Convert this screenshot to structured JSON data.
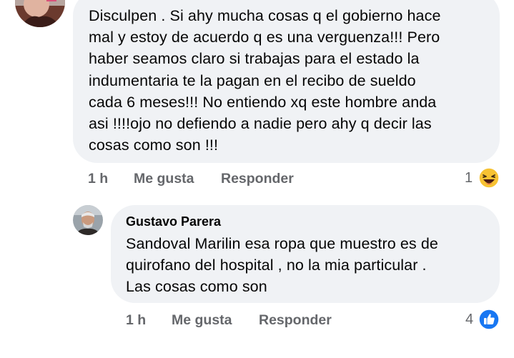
{
  "comment1": {
    "text": "Disculpen . Si ahy mucha cosas q el gobierno hace\nmal y estoy de acuerdo q es una verguenza!!! Pero\nhaber seamos claro si trabajas para el estado la\nindumentaria te la pagan en el recibo de sueldo\ncada 6 meses!!! No entiendo xq este hombre anda\nasi !!!!ojo no defiendo a nadie pero ahy q decir las\ncosas como son !!!",
    "time": "1 h",
    "like_label": "Me gusta",
    "reply_label": "Responder",
    "reaction_count": "1",
    "reaction_icon": "haha-emoji-icon"
  },
  "comment2": {
    "author": "Gustavo Parera",
    "text": "Sandoval Marilin  esa ropa que muestro es de\nquirofano del hospital , no la mia particular .\nLas cosas como son",
    "time": "1 h",
    "like_label": "Me gusta",
    "reply_label": "Responder",
    "reaction_count": "4",
    "reaction_icon": "like-thumb-icon"
  },
  "colors": {
    "bubble": "#f0f2f5",
    "text": "#050505",
    "meta": "#65676b",
    "like_blue": "#1877f2",
    "haha_yellow": "#f7c232"
  }
}
